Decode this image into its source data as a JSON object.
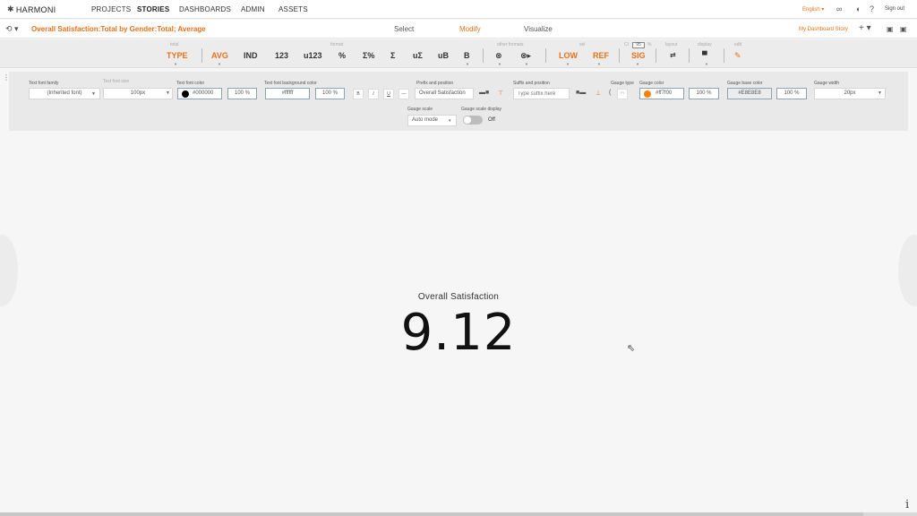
{
  "app": {
    "logo": "HARMONI"
  },
  "nav": {
    "items": [
      "PROJECTS",
      "STORIES",
      "DASHBOARDS",
      "ADMIN",
      "ASSETS"
    ],
    "language": "English ▾",
    "signout": "Sign out"
  },
  "titlebar": {
    "story_title": "Overall Satisfaction:Total by Gender:Total; Average",
    "modes": [
      "Select",
      "Modify",
      "Visualize"
    ],
    "active_mode": "Modify",
    "dashboard_link": "My Dashboard Story"
  },
  "toolbar": {
    "group_labels": {
      "total": "total",
      "format": "format",
      "other_formats": "other formats",
      "sel": "sel",
      "ci": "CI",
      "ci_value": "95",
      "ci_pct": "%",
      "layout": "layout",
      "display": "display",
      "edit": "edit"
    },
    "buttons": {
      "type": "TYPE",
      "avg": "AVG",
      "ind": "IND",
      "n123": "123",
      "u123": "u123",
      "pct": "%",
      "sigma_pct": "Σ%",
      "sigma": "Σ",
      "u_sigma": "uΣ",
      "ub": "uB",
      "b": "B",
      "low": "LOW",
      "ref": "REF",
      "sig": "SIG"
    }
  },
  "properties": {
    "text_font_family": {
      "label": "Text font family",
      "value": "(Inherited font)"
    },
    "text_font_size": {
      "label": "Text font size",
      "value": "100px"
    },
    "text_font_color": {
      "label": "Text font color",
      "value": "#000000",
      "opacity": "100 %",
      "swatch": "#000000"
    },
    "text_font_bg": {
      "label": "Text font background color",
      "value": "#ffffff",
      "opacity": "100 %"
    },
    "style_buttons": [
      "B",
      "I",
      "U",
      "—"
    ],
    "prefix": {
      "label": "Prefix and position",
      "value": "Overall Satisfaction"
    },
    "suffix": {
      "label": "Suffix and position",
      "placeholder": "Type suffix here"
    },
    "gauge_type": {
      "label": "Gauge type"
    },
    "gauge_color": {
      "label": "Gauge color",
      "value": "#ff7f00",
      "opacity": "100 %",
      "swatch": "#ff7f00"
    },
    "gauge_base_color": {
      "label": "Gauge base color",
      "value": "#E8E8E8",
      "opacity": "100 %"
    },
    "gauge_width": {
      "label": "Gauge width",
      "value": "20px"
    },
    "gauge_scale": {
      "label": "Gauge scale",
      "value": "Auto mode"
    },
    "gauge_scale_display": {
      "label": "Gauge scale display",
      "state": "Off"
    }
  },
  "kpi": {
    "title": "Overall Satisfaction",
    "value": "9.12"
  },
  "colors": {
    "accent": "#e8711a"
  }
}
